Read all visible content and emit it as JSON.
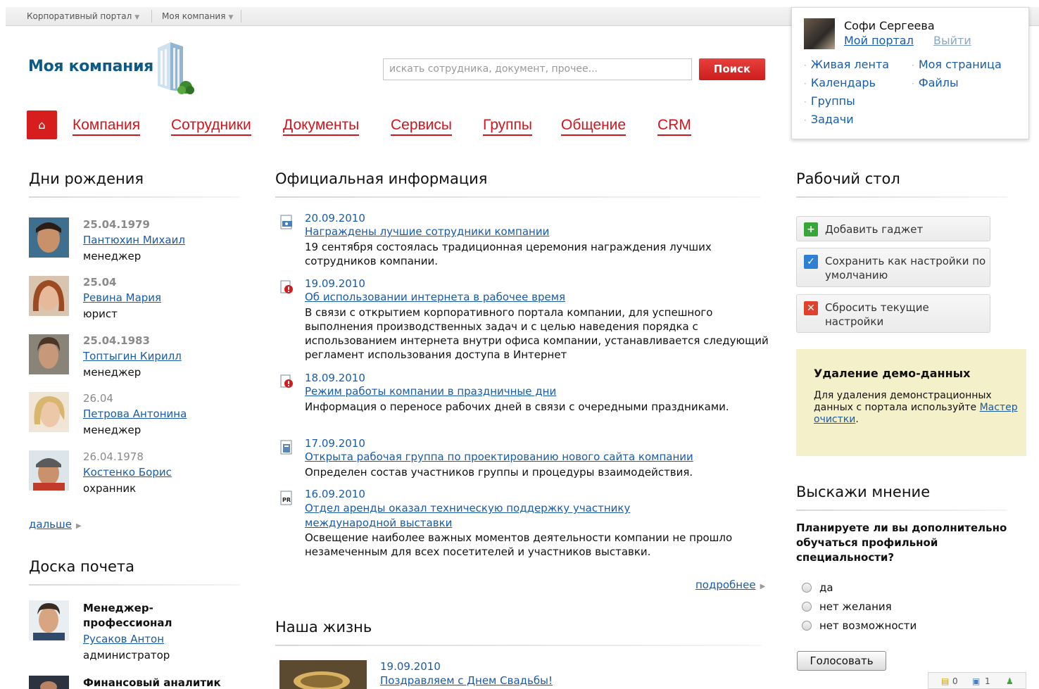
{
  "topbar": {
    "portal_label": "Корпоративный портал",
    "company_label": "Моя компания"
  },
  "header": {
    "logo_text": "Моя компания",
    "search_placeholder": "искать сотрудника, документ, прочее...",
    "search_button": "Поиск"
  },
  "nav": {
    "home_icon": "home-icon",
    "items": [
      "Компания",
      "Сотрудники",
      "Документы",
      "Сервисы",
      "Группы",
      "Общение",
      "CRM"
    ]
  },
  "user_panel": {
    "name": "Софи Сергеева",
    "my_portal": "Мой портал",
    "logout": "Выйти",
    "links": [
      "Живая лента",
      "Моя страница",
      "Календарь",
      "Файлы",
      "Группы",
      "Задачи"
    ]
  },
  "birthdays": {
    "title": "Дни рождения",
    "people": [
      {
        "date": "25.04.1979",
        "name": "Пантюхин Михаил",
        "role": "менеджер"
      },
      {
        "date": "25.04",
        "name": "Ревина Мария",
        "role": "юрист"
      },
      {
        "date": "25.04.1983",
        "name": "Топтыгин Кирилл",
        "role": "менеджер"
      },
      {
        "date": "26.04",
        "name": "Петрова Антонина",
        "role": "менеджер"
      },
      {
        "date": "26.04.1978",
        "name": "Костенко Борис",
        "role": "охранник"
      }
    ],
    "more": "дальше"
  },
  "honor_board": {
    "title": "Доска почета",
    "items": [
      {
        "title": "Менеджер-профессионал",
        "name": "Русаков Антон",
        "role": "администратор"
      },
      {
        "title": "Финансовый аналитик"
      }
    ]
  },
  "official": {
    "title": "Официальная информация",
    "news": [
      {
        "date": "20.09.2010",
        "title": "Награждены лучшие сотрудники компании",
        "text": "19 сентября состоялась традиционная церемония награждения лучших сотрудников компании.",
        "icon": "award-doc-icon"
      },
      {
        "date": "19.09.2010",
        "title": "Об использовании интернета в рабочее время",
        "text": "В связи с открытием корпоративного портала компании, для успешного выполнения производственных задач и с целью наведения порядка с использованием интернета внутри офиса компании, устанавливается следующий регламент использования доступа в Интернет",
        "icon": "important-doc-icon"
      },
      {
        "date": "18.09.2010",
        "title": "Режим работы компании в праздничные дни",
        "text": "Информация о переносе рабочих дней в связи с очередными праздниками.",
        "icon": "important-doc-icon"
      },
      {
        "date": "17.09.2010",
        "title": "Открыта рабочая группа по проектированию нового сайта компании",
        "text": "Определен состав участников группы и процедуры взаимодействия.",
        "icon": "calc-doc-icon"
      },
      {
        "date": "16.09.2010",
        "title": "Отдел аренды оказал техническую поддержку участнику международной выставки",
        "text": "Освещение наиболее важных моментов деятельности компании не прошло незамеченным для всех посетителей и участников выставки.",
        "icon": "pr-doc-icon"
      }
    ],
    "more": "подробнее"
  },
  "our_life": {
    "title": "Наша жизнь",
    "items": [
      {
        "date": "19.09.2010",
        "title": "Поздравляем с Днем Свадьбы!"
      }
    ]
  },
  "desktop": {
    "title": "Рабочий стол",
    "buttons": [
      {
        "label": "Добавить гаджет",
        "icon": "plus-icon",
        "color": "#3aa53a"
      },
      {
        "label": "Сохранить как настройки по умолчанию",
        "icon": "check-icon",
        "color": "#2f7fd2"
      },
      {
        "label": "Сбросить текущие настройки",
        "icon": "x-icon",
        "color": "#e0412f"
      }
    ]
  },
  "demo": {
    "title": "Удаление демо-данных",
    "text": "Для удаления демонстрационных данных с портала используйте ",
    "link": "Мастер очистки",
    "tail": "."
  },
  "poll": {
    "title": "Выскажи мнение",
    "question": "Планируете ли вы дополнительно обучаться профильной специальности?",
    "options": [
      "да",
      "нет желания",
      "нет возможности"
    ],
    "vote": "Голосовать"
  },
  "status": {
    "messages": "0",
    "notifications": "1"
  },
  "colors": {
    "accent_red": "#d3141c",
    "link_blue": "#1a5ba8",
    "logo_blue": "#0c5a85"
  }
}
